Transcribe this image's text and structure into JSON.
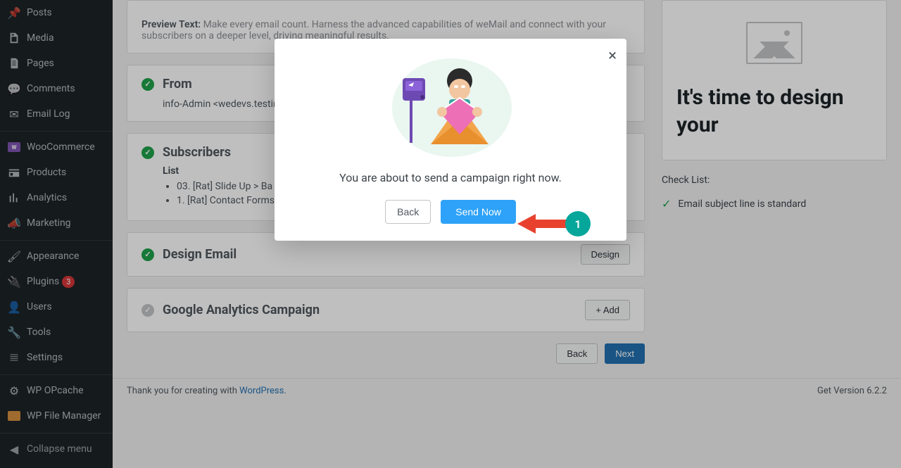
{
  "sidebar": {
    "items": [
      {
        "label": "Posts",
        "icon": "pin-icon"
      },
      {
        "label": "Media",
        "icon": "media-icon"
      },
      {
        "label": "Pages",
        "icon": "page-icon"
      },
      {
        "label": "Comments",
        "icon": "comment-icon"
      },
      {
        "label": "Email Log",
        "icon": "email-icon"
      },
      {
        "label": "WooCommerce",
        "icon": "woo-icon"
      },
      {
        "label": "Products",
        "icon": "products-icon"
      },
      {
        "label": "Analytics",
        "icon": "analytics-icon"
      },
      {
        "label": "Marketing",
        "icon": "marketing-icon"
      },
      {
        "label": "Appearance",
        "icon": "appearance-icon"
      },
      {
        "label": "Plugins",
        "icon": "plugin-icon",
        "badge": "3"
      },
      {
        "label": "Users",
        "icon": "users-icon"
      },
      {
        "label": "Tools",
        "icon": "tools-icon"
      },
      {
        "label": "Settings",
        "icon": "settings-icon"
      },
      {
        "label": "WP OPcache",
        "icon": "gear-icon"
      },
      {
        "label": "WP File Manager",
        "icon": "file-manager-icon"
      },
      {
        "label": "Collapse menu",
        "icon": "collapse-icon"
      }
    ]
  },
  "preview_card": {
    "label": "Preview Text:",
    "text": "Make every email count. Harness the advanced capabilities of weMail and connect with your subscribers on a deeper level, driving meaningful results."
  },
  "from_card": {
    "title": "From",
    "value": "info-Admin <wedevs.testing"
  },
  "subscribers_card": {
    "title": "Subscribers",
    "list_label": "List",
    "items": [
      "03. [Rat] Slide Up > Ba",
      "1. [Rat] Contact Forms"
    ]
  },
  "design_card": {
    "title": "Design Email",
    "button": "Design"
  },
  "ga_card": {
    "title": "Google Analytics Campaign",
    "button": "+ Add"
  },
  "nav": {
    "back": "Back",
    "next": "Next"
  },
  "right_panel": {
    "title": "It's time to design your",
    "checklist_title": "Check List:",
    "checklist_item": "Email subject line is standard"
  },
  "footer": {
    "prefix": "Thank you for creating with ",
    "link": "WordPress",
    "suffix": ".",
    "version": "Get Version 6.2.2"
  },
  "modal": {
    "message": "You are about to send a campaign right now.",
    "back": "Back",
    "send": "Send Now"
  },
  "annotation": {
    "number": "1"
  }
}
